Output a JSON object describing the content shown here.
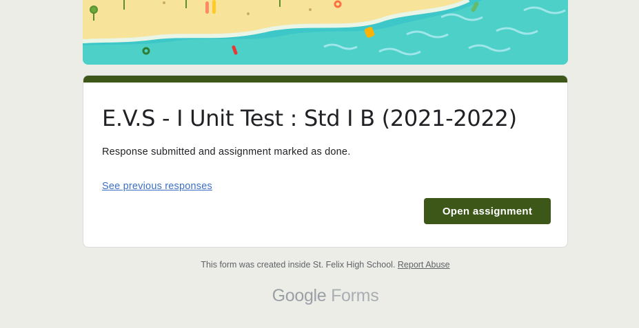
{
  "banner": {
    "icon": "beach-illustration"
  },
  "form": {
    "title": "E.V.S - I Unit Test : Std I B (2021-2022)",
    "message": "Response submitted and assignment marked as done.",
    "previous_link": "See previous responses",
    "open_button": "Open assignment"
  },
  "footer": {
    "created_text": "This form was created inside St. Felix High School. ",
    "report_abuse": "Report Abuse",
    "brand_google": "Google",
    "brand_forms": " Forms"
  },
  "colors": {
    "accent": "#3d5719",
    "background": "#ebede6",
    "link": "#3b6fc7"
  }
}
